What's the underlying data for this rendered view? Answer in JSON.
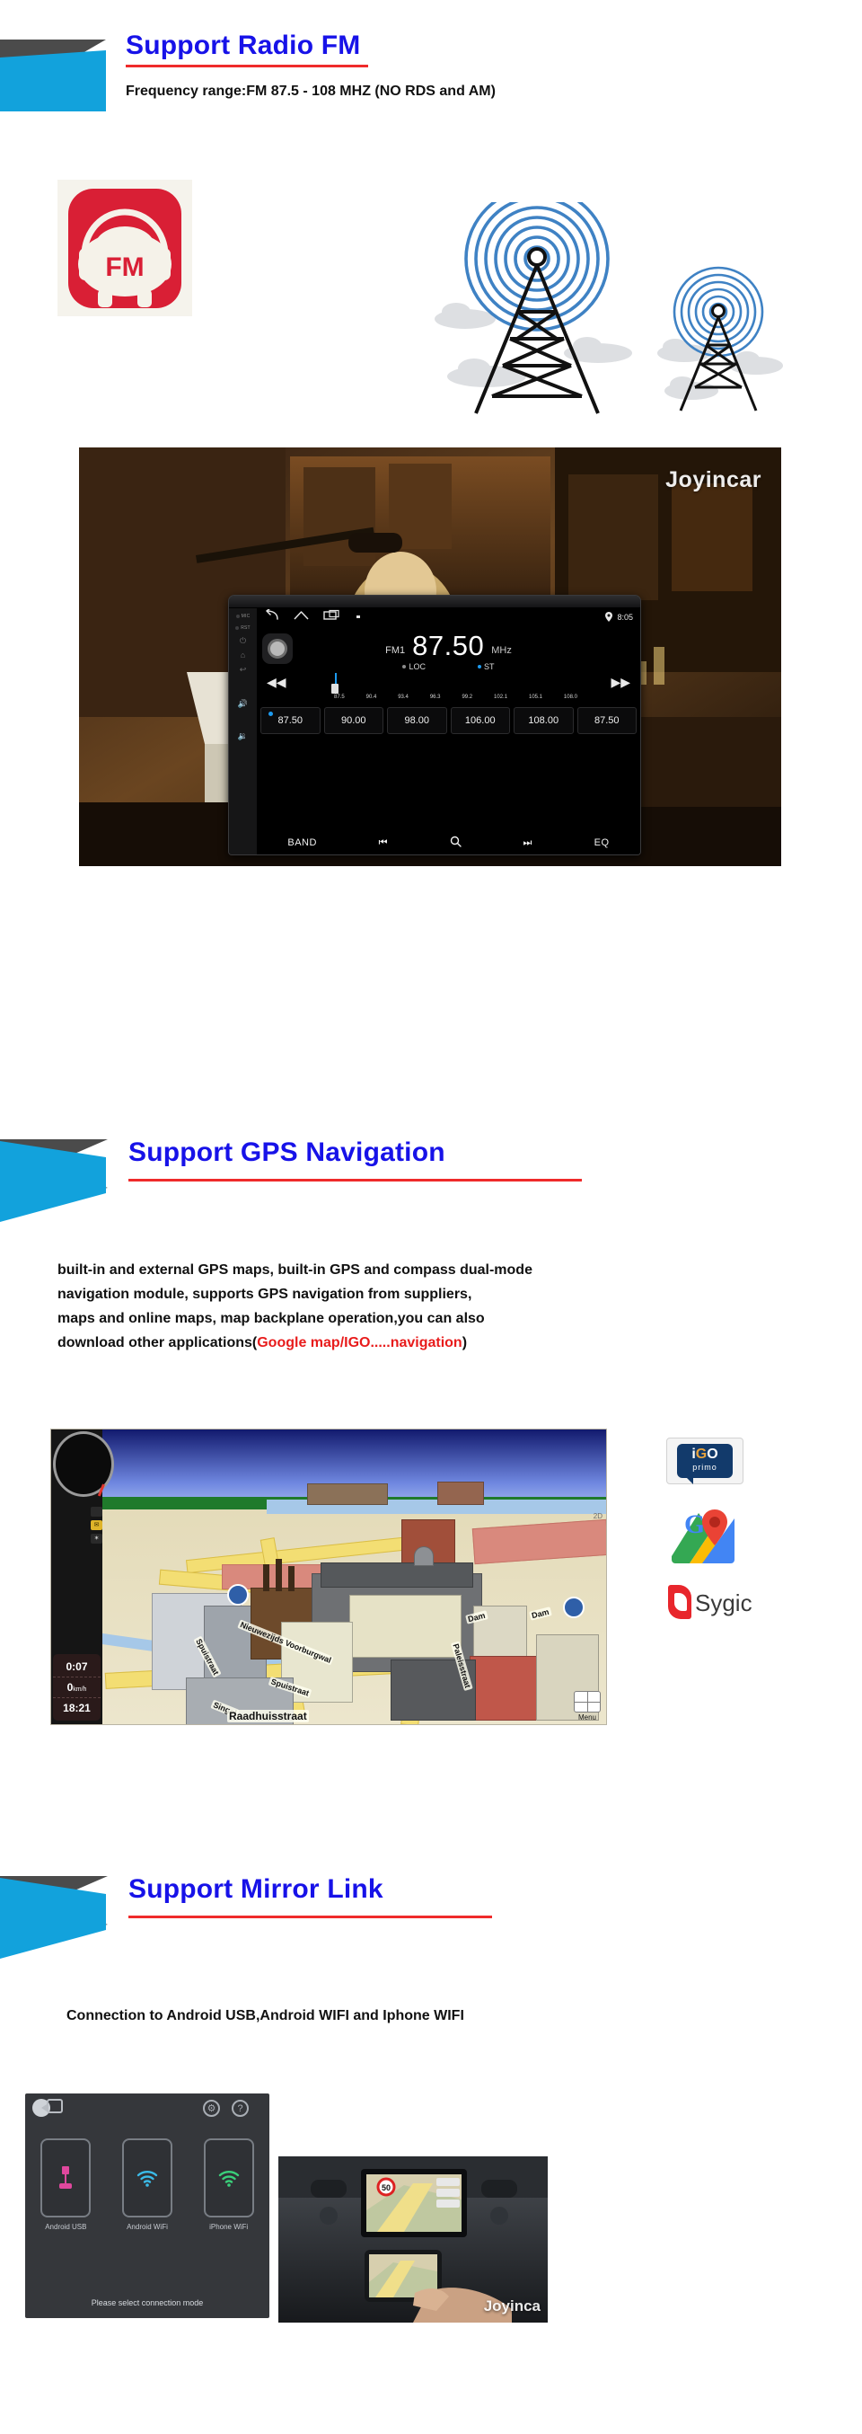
{
  "theme": {
    "heading_color": "#1712e8",
    "rule_color": "#ef2b2b",
    "accent_cyan": "#12a2dc",
    "accent_gray": "#4b4b4b",
    "fm_red": "#d91f35",
    "tower_blue": "#3f82c4"
  },
  "sections": [
    {
      "id": "radio",
      "heading": "Support Radio FM",
      "subtitle": "Frequency range:FM 87.5 - 108 MHZ (NO RDS and AM)",
      "fm_icon_label": "FM"
    },
    {
      "id": "gps",
      "heading": "Support GPS Navigation",
      "paragraph_lines": [
        "built-in and external GPS maps, built-in GPS and compass dual-mode",
        "navigation module, supports GPS navigation from suppliers,",
        "maps and online maps, map backplane operation,you can also",
        "download other applications("
      ],
      "paragraph_highlight": "Google map/IGO.....navigation",
      "paragraph_tail": ")"
    },
    {
      "id": "mirror",
      "heading": "Support Mirror Link",
      "subtitle": "Connection to Android USB,Android WIFI and Iphone WIFI"
    }
  ],
  "radio_unit": {
    "watermark": "Joyincar",
    "statusbar": {
      "back_icon": "back-arrow-icon",
      "home_icon": "home-icon",
      "recents_icon": "recents-icon",
      "more_icon": "more-icon",
      "location_icon": "location-pin-icon",
      "time": "8:05"
    },
    "band": "FM1",
    "frequency": "87.50",
    "unit": "MHz",
    "indicators": [
      {
        "label": "LOC",
        "active": false
      },
      {
        "label": "ST",
        "active": true
      }
    ],
    "seek_back_icon": "seek-backward-icon",
    "seek_forward_icon": "seek-forward-icon",
    "tuner_scale": [
      "87.5",
      "90.4",
      "93.4",
      "96.3",
      "99.2",
      "102.1",
      "105.1",
      "108.0"
    ],
    "presets": [
      {
        "value": "87.50",
        "selected": true
      },
      {
        "value": "90.00",
        "selected": false
      },
      {
        "value": "98.00",
        "selected": false
      },
      {
        "value": "106.00",
        "selected": false
      },
      {
        "value": "108.00",
        "selected": false
      },
      {
        "value": "87.50",
        "selected": false
      }
    ],
    "bottom_bar": [
      {
        "label": "BAND",
        "icon": ""
      },
      {
        "label": "",
        "icon": "prev-track-icon"
      },
      {
        "label": "",
        "icon": "search-icon"
      },
      {
        "label": "",
        "icon": "next-track-icon"
      },
      {
        "label": "EQ",
        "icon": ""
      }
    ],
    "side_buttons": [
      "MIC",
      "RST",
      "power-icon",
      "home-icon",
      "back-icon",
      "volume-up-icon",
      "volume-down-icon"
    ]
  },
  "gps_screenshot": {
    "trip_time": "0:07",
    "speed_value": "0",
    "speed_unit": "km/h",
    "clock": "18:21",
    "menu_label": "Menu",
    "view_mode": "2D",
    "street_labels": [
      "Nieuwezijds Voorburgwal",
      "Spuistraat",
      "Spuistraat",
      "Singel",
      "Raadhuisstraat",
      "Dam",
      "Dam",
      "Paleisstraat"
    ]
  },
  "nav_apps": [
    {
      "name": "iGO primo",
      "line1": "iGO",
      "line2": "primo",
      "icon": "igo-primo-logo"
    },
    {
      "name": "Google Maps",
      "letter": "G",
      "icon": "google-maps-logo"
    },
    {
      "name": "Sygic",
      "word": "Sygic",
      "icon": "sygic-logo"
    }
  ],
  "mirror_link_ui": {
    "back_icon": "back-icon",
    "settings_icon": "gear-icon",
    "help_icon": "help-icon",
    "options": [
      {
        "label": "Android USB",
        "icon": "usb-icon",
        "color": "#e0489e"
      },
      {
        "label": "Android WiFi",
        "icon": "wifi-icon",
        "color": "#3bbbe8"
      },
      {
        "label": "iPhone WiFi",
        "icon": "wifi-icon",
        "color": "#3ad07a"
      }
    ],
    "hint": "Please select connection mode",
    "photo_watermark": "Joyinca",
    "photo_speed_sign": "50"
  }
}
